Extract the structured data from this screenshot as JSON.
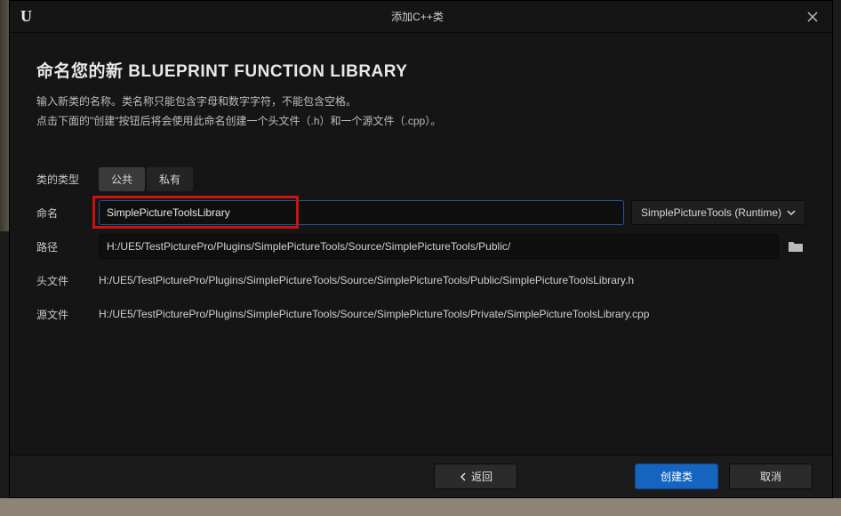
{
  "window": {
    "title": "添加C++类"
  },
  "page": {
    "title_prefix": "命名您的新 ",
    "title_strong": "BLUEPRINT FUNCTION LIBRARY",
    "desc_line1": "输入新类的名称。类名称只能包含字母和数字字符，不能包含空格。",
    "desc_line2": "点击下面的\"创建\"按钮后将会使用此命名创建一个头文件（.h）和一个源文件（.cpp）。"
  },
  "form": {
    "class_type_label": "类的类型",
    "tab_public": "公共",
    "tab_private": "私有",
    "name_label": "命名",
    "name_value": "SimplePictureToolsLibrary",
    "plugin_selector": "SimplePictureTools (Runtime)",
    "path_label": "路径",
    "path_value": "H:/UE5/TestPicturePro/Plugins/SimplePictureTools/Source/SimplePictureTools/Public/",
    "header_label": "头文件",
    "header_value": "H:/UE5/TestPicturePro/Plugins/SimplePictureTools/Source/SimplePictureTools/Public/SimplePictureToolsLibrary.h",
    "source_label": "源文件",
    "source_value": "H:/UE5/TestPicturePro/Plugins/SimplePictureTools/Source/SimplePictureTools/Private/SimplePictureToolsLibrary.cpp"
  },
  "footer": {
    "back": "返回",
    "create": "创建类",
    "cancel": "取消"
  }
}
